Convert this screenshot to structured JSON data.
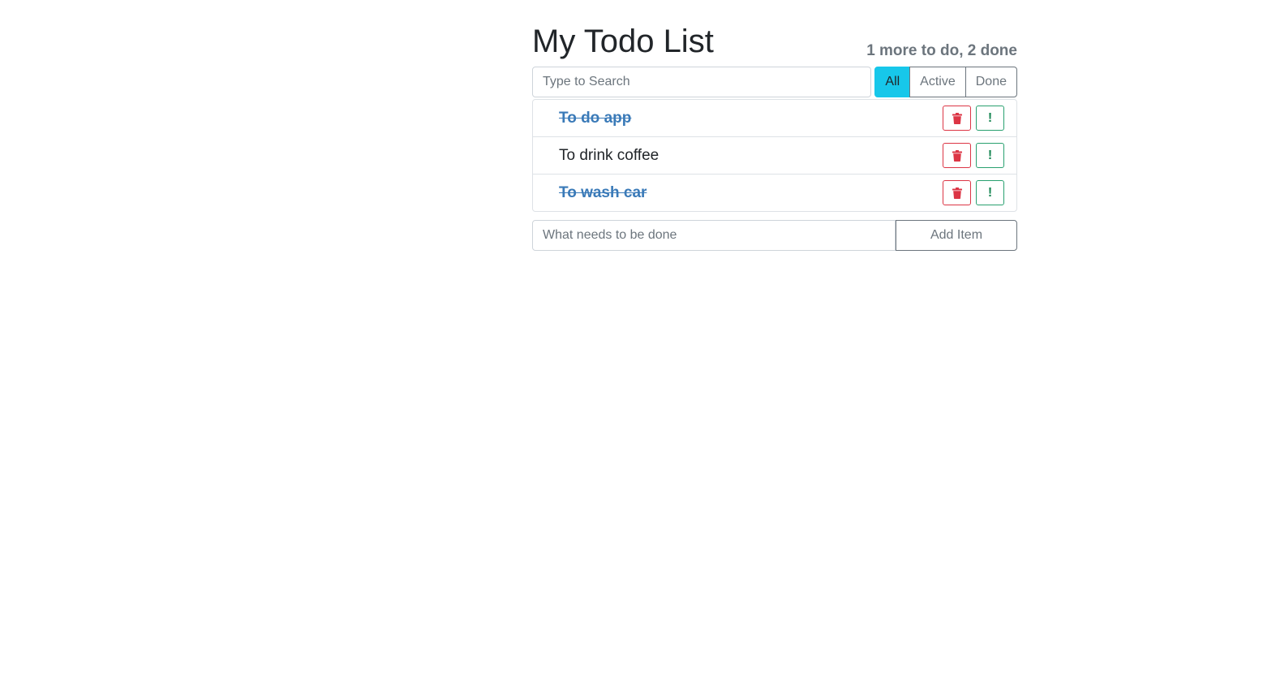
{
  "header": {
    "title": "My Todo List",
    "counter": "1 more to do, 2 done"
  },
  "search": {
    "placeholder": "Type to Search",
    "value": ""
  },
  "filters": [
    {
      "label": "All",
      "active": true
    },
    {
      "label": "Active",
      "active": false
    },
    {
      "label": "Done",
      "active": false
    }
  ],
  "todos": [
    {
      "label": "To do app",
      "done": true
    },
    {
      "label": "To drink coffee",
      "done": false
    },
    {
      "label": "To wash car",
      "done": true
    }
  ],
  "todo_actions": {
    "delete_icon": "trash-icon",
    "important_label": "!"
  },
  "add_form": {
    "placeholder": "What needs to be done",
    "value": "",
    "button_label": "Add Item"
  },
  "colors": {
    "active_filter": "#17c7ea",
    "done_text": "#3a7ab8",
    "danger": "#dc3545",
    "success": "#198754",
    "muted": "#6c757d"
  }
}
